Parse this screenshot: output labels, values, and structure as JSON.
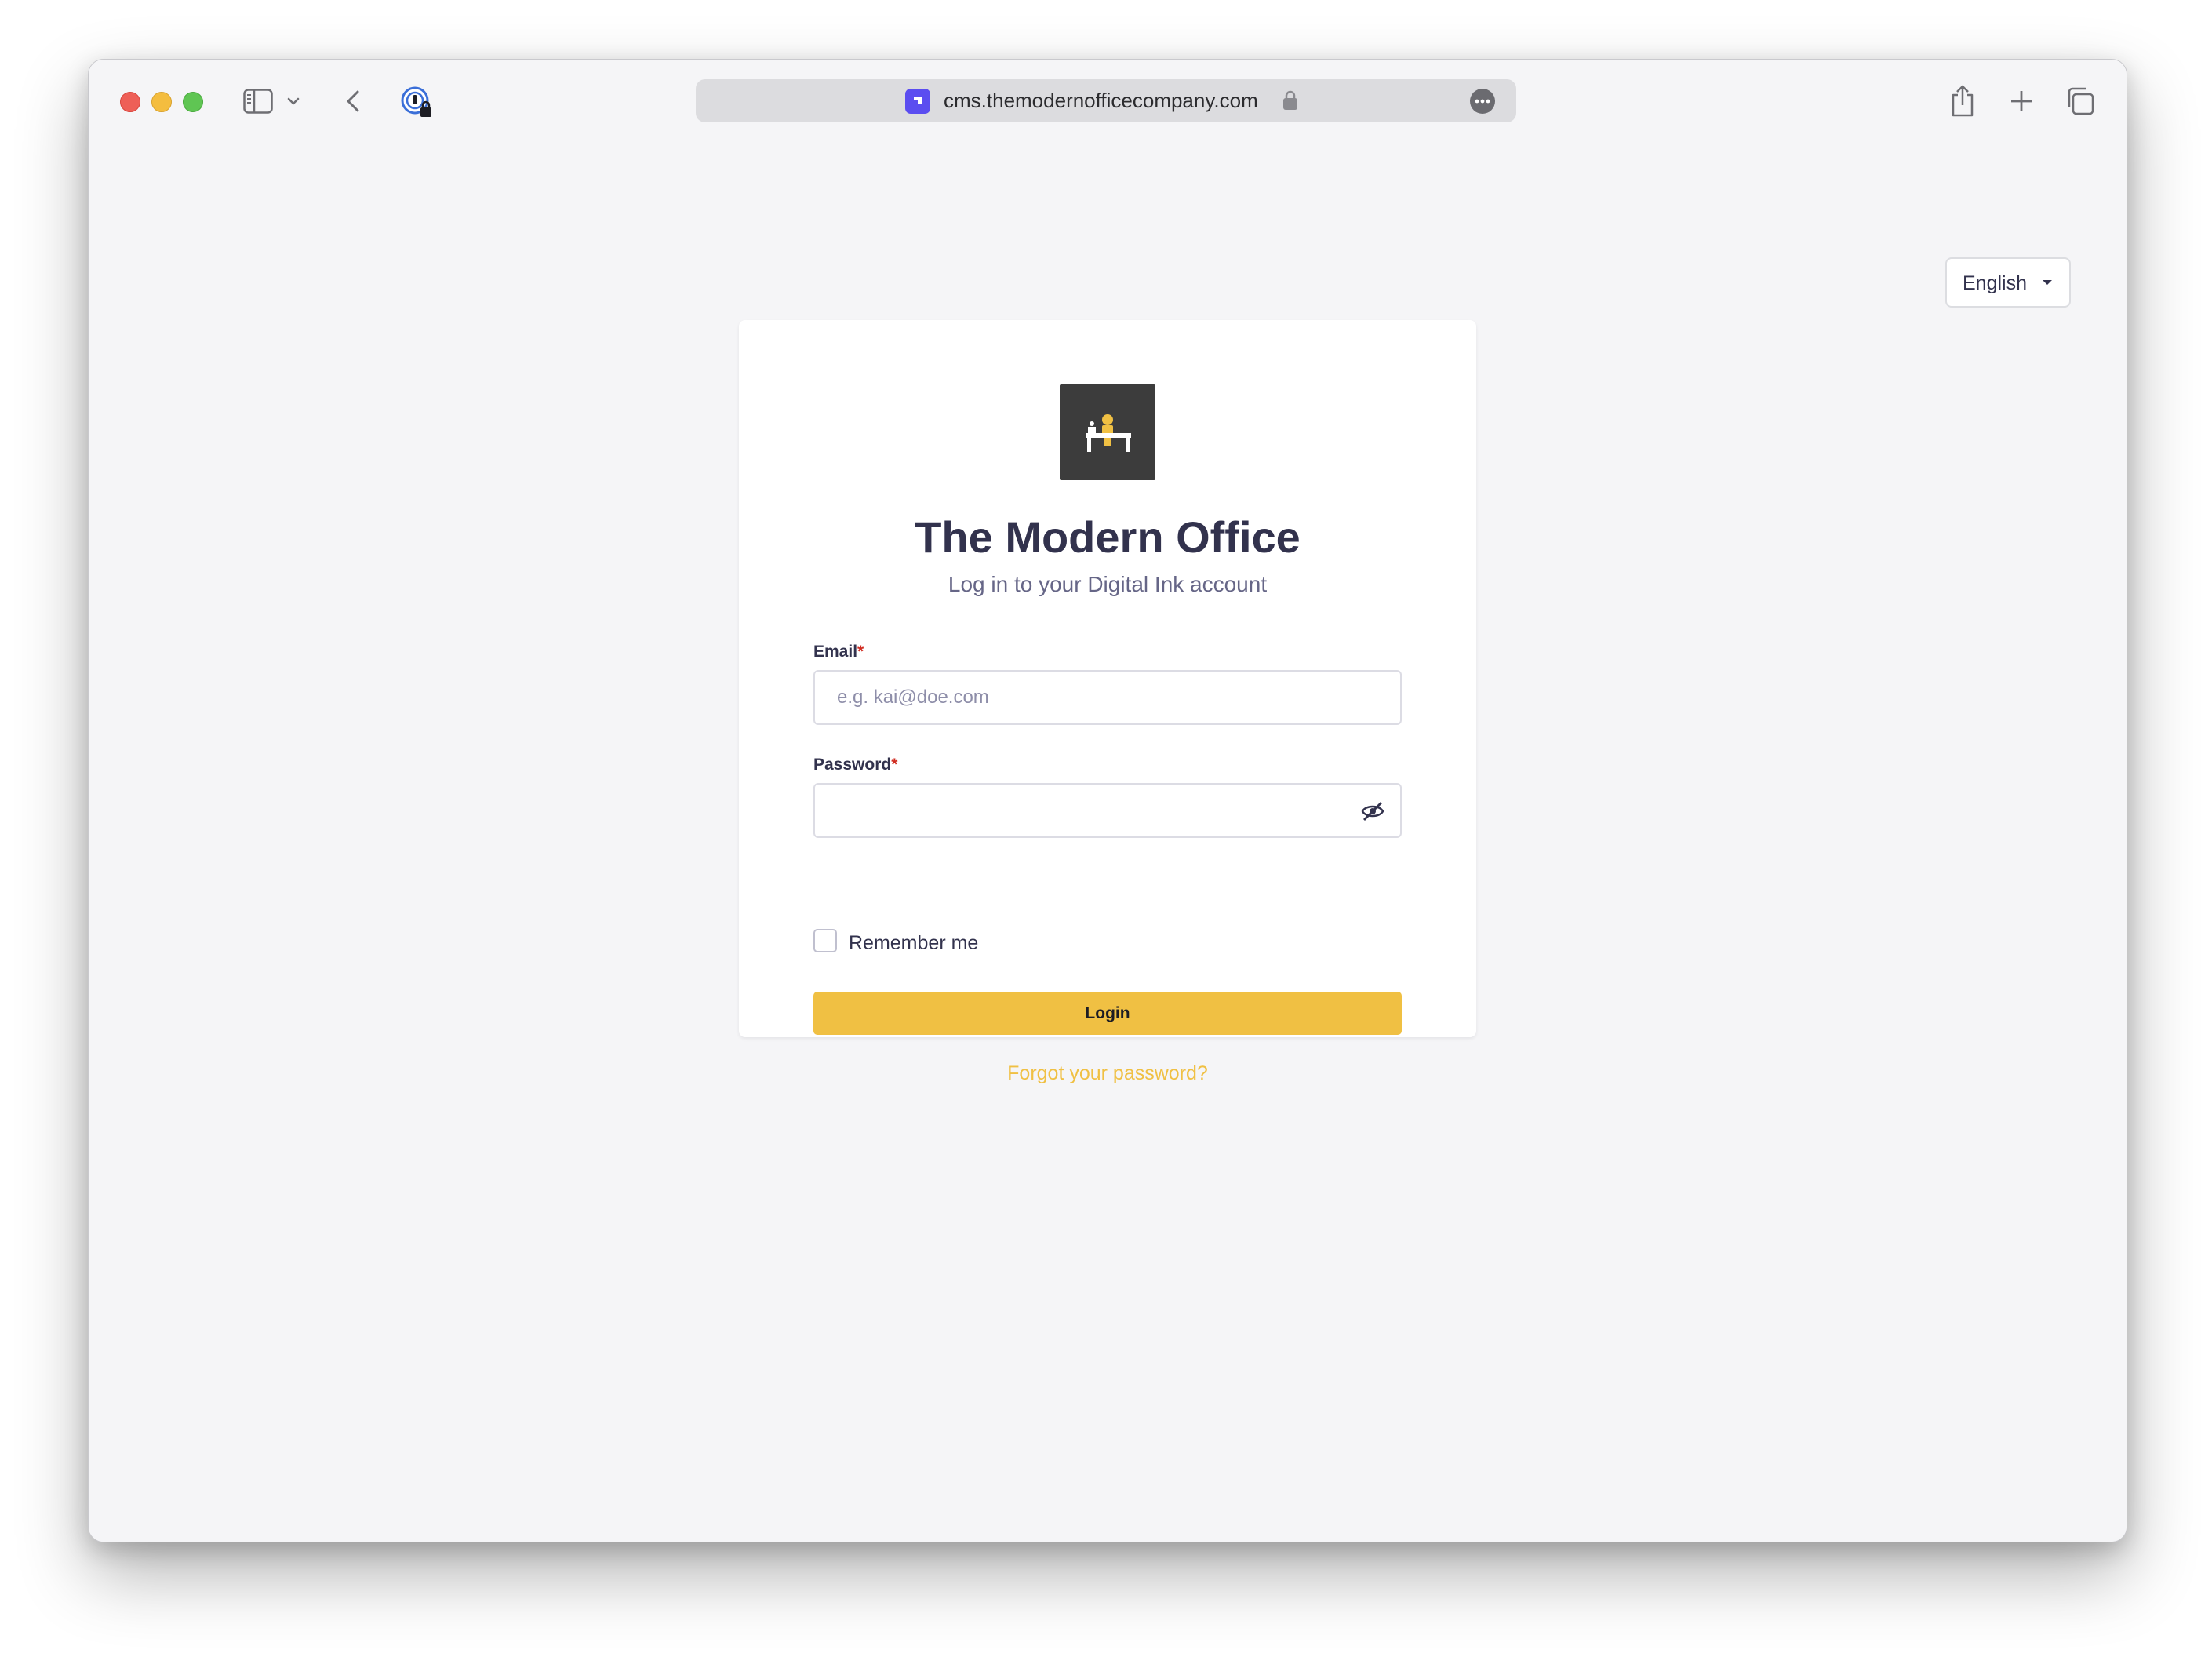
{
  "browser": {
    "url": "cms.themodernofficecompany.com",
    "icons": {
      "sidebar": "sidebar-toggle-icon",
      "chevron": "chevron-down-icon",
      "back": "back-arrow-icon",
      "password_manager": "password-manager-icon",
      "lock": "lock-icon",
      "more": "more-icon",
      "share": "share-icon",
      "new_tab": "plus-icon",
      "tabs": "tab-overview-icon"
    }
  },
  "language_select": {
    "value": "English"
  },
  "login": {
    "title": "The Modern Office",
    "subtitle": "Log in to your Digital Ink account",
    "email": {
      "label": "Email",
      "required_mark": "*",
      "placeholder": "e.g. kai@doe.com",
      "value": ""
    },
    "password": {
      "label": "Password",
      "required_mark": "*",
      "value": ""
    },
    "remember_label": "Remember me",
    "remember_checked": false,
    "submit_label": "Login",
    "forgot_label": "Forgot your password?"
  },
  "colors": {
    "accent": "#f0c043",
    "text_primary": "#32324d",
    "text_secondary": "#666687",
    "required": "#d02b20",
    "logo_bg": "#3c3c3c"
  }
}
